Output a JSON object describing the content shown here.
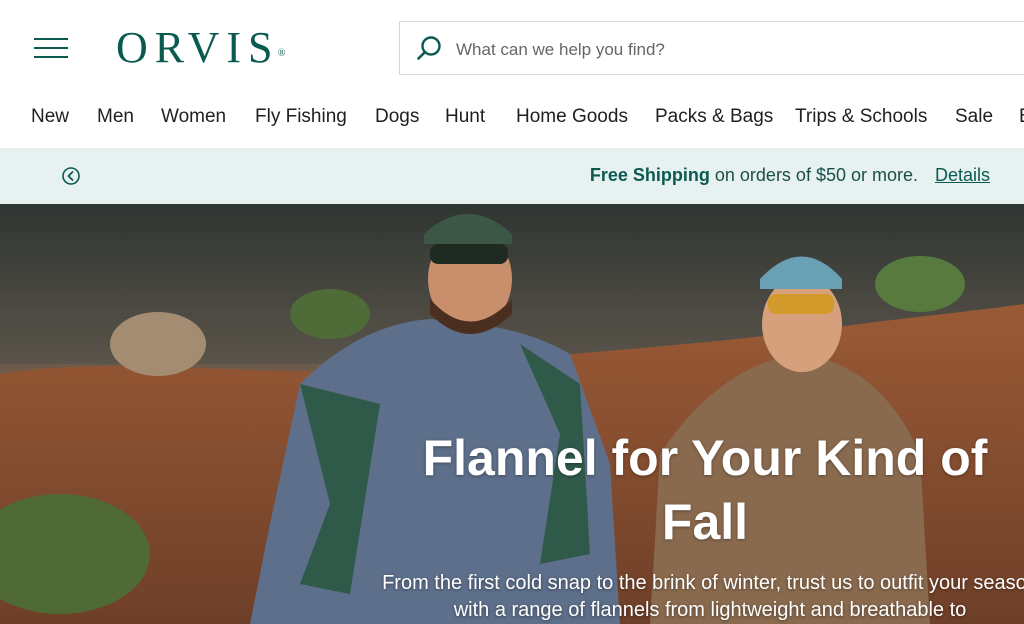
{
  "brand": {
    "name": "ORVIS",
    "registered_mark": "®",
    "color": "#0b5a50"
  },
  "search": {
    "placeholder": "What can we help you find?",
    "value": ""
  },
  "nav": {
    "items": [
      "New",
      "Men",
      "Women",
      "Fly Fishing",
      "Dogs",
      "Hunt",
      "Home Goods",
      "Packs & Bags",
      "Trips & Schools",
      "Sale",
      "B"
    ]
  },
  "promo": {
    "bold": "Free Shipping",
    "text": " on orders of $50 or more.",
    "link": "Details",
    "bg_color": "#e6f1f0"
  },
  "hero": {
    "headline": "Flannel for Your Kind of Fall",
    "subtitle": "From the first cold snap to the brink of winter, trust us to outfit your season with a range of flannels from lightweight and breathable to"
  },
  "icons": {
    "menu": "hamburger-menu-icon",
    "search": "search-icon",
    "carousel_prev": "chevron-left-circle-icon"
  }
}
